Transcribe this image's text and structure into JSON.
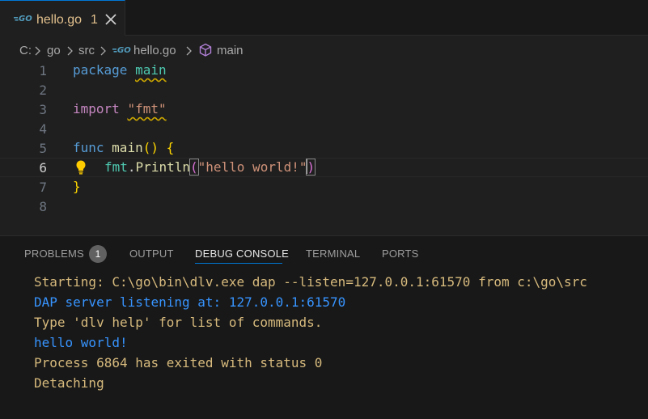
{
  "tab": {
    "filename": "hello.go",
    "badge": "1"
  },
  "breadcrumb": {
    "drive": "C:",
    "folder1": "go",
    "folder2": "src",
    "file": "hello.go",
    "symbol": "main"
  },
  "editor": {
    "line_numbers": [
      "1",
      "2",
      "3",
      "4",
      "5",
      "6",
      "7",
      "8"
    ],
    "line1": {
      "keyword": "package",
      "name": "main"
    },
    "line3": {
      "keyword": "import",
      "string": "\"fmt\""
    },
    "line5": {
      "keyword": "func",
      "name": "main",
      "parens": "()",
      "brace": "{"
    },
    "line6": {
      "pkg": "fmt",
      "dot": ".",
      "func": "Println",
      "open": "(",
      "string": "\"hello world!\"",
      "close": ")"
    },
    "line7": {
      "brace": "}"
    }
  },
  "panel": {
    "tabs": {
      "problems": "PROBLEMS",
      "problems_badge": "1",
      "output": "OUTPUT",
      "debug_console": "DEBUG CONSOLE",
      "terminal": "TERMINAL",
      "ports": "PORTS"
    },
    "console_lines": [
      "Starting: C:\\go\\bin\\dlv.exe dap --listen=127.0.0.1:61570 from c:\\go\\src",
      "DAP server listening at: 127.0.0.1:61570",
      "Type 'dlv help' for list of commands.",
      "hello world!",
      "Process 6864 has exited with status 0",
      "Detaching"
    ]
  },
  "colors": {
    "accent": "#0078d4",
    "modified": "#e2c08d",
    "console_warn": "#d7ba7d",
    "console_info": "#3794ff"
  }
}
